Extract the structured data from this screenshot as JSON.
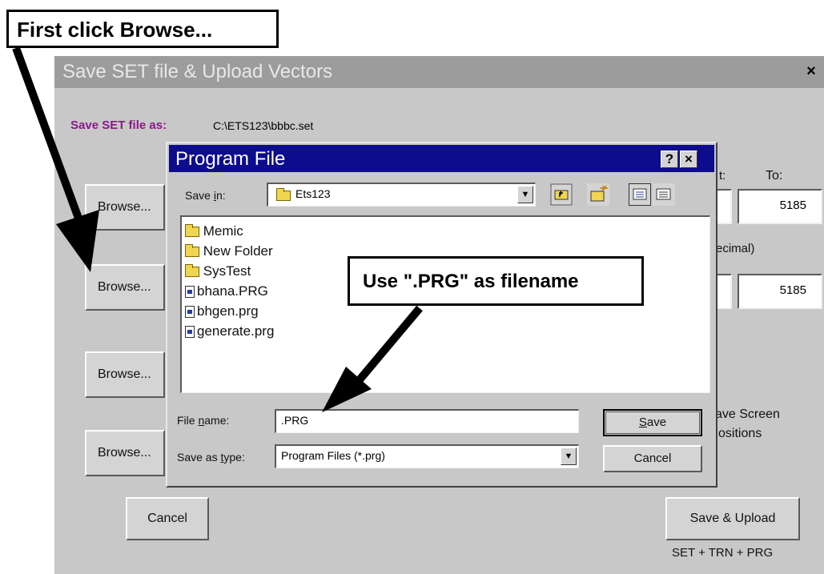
{
  "annotations": {
    "first_callout": "First click Browse...",
    "filename_callout": "Use \".PRG\" as filename"
  },
  "outer_dialog": {
    "title": "Save SET file & Upload Vectors",
    "close": "×",
    "save_set_label": "Save SET file as:",
    "save_set_path": "C:\\ETS123\\bbbc.set",
    "browse_label": "Browse...",
    "from_partial": "t:",
    "to_label": "To:",
    "to_value_1": "5185",
    "decimal_partial": "ecimal)",
    "to_value_2": "5185",
    "save_screen_line1": "ave Screen",
    "save_screen_line2": "ositions",
    "cancel_label": "Cancel",
    "save_upload_label": "Save & Upload",
    "save_upload_sub": "SET + TRN + PRG"
  },
  "program_file_dialog": {
    "title": "Program File",
    "help": "?",
    "close": "×",
    "save_in_label_pre": "Save ",
    "save_in_label_u": "i",
    "save_in_label_post": "n:",
    "save_in_value": "Ets123",
    "files": [
      "Memic",
      "New Folder",
      "SysTest",
      "bhana.PRG",
      "bhgen.prg",
      "generate.prg"
    ],
    "file_name_label_pre": "File ",
    "file_name_label_u": "n",
    "file_name_label_post": "ame:",
    "file_name_value": ".PRG",
    "save_type_label_pre": "Save as ",
    "save_type_label_u": "t",
    "save_type_label_post": "ype:",
    "save_type_value": "Program Files (*.prg)",
    "save_label_u": "S",
    "save_label_post": "ave",
    "cancel_label": "Cancel"
  },
  "colors": {
    "inner_title_bg": "#0c0c8c",
    "outer_title_bg": "#9c9c9c",
    "save_set_label": "#8a1a8a"
  }
}
